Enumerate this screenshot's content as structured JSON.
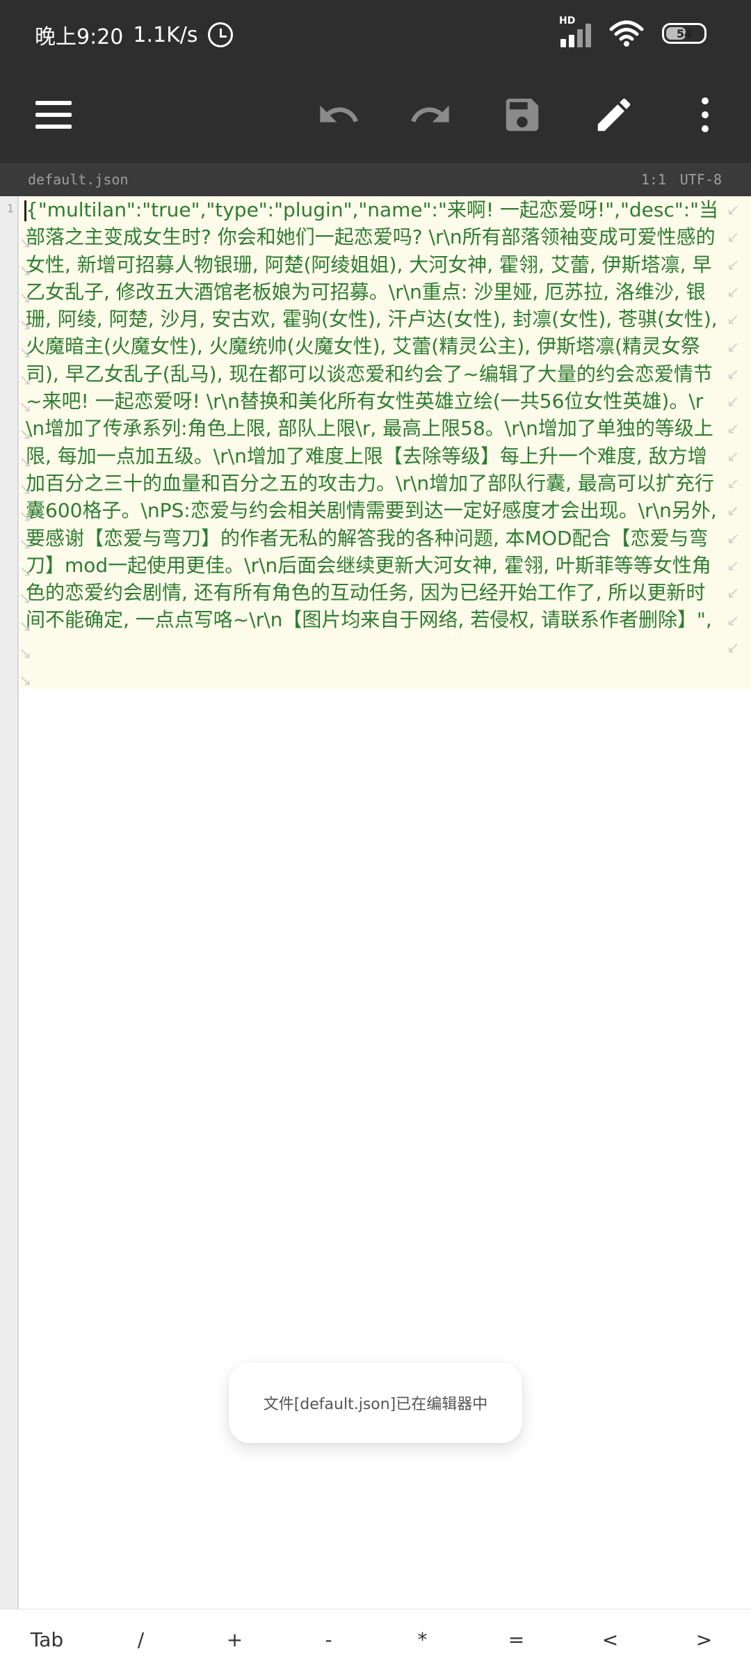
{
  "status_bar": {
    "time": "晚上9:20",
    "net_speed": "1.1K/s",
    "battery_level": "54",
    "signal_label": "HD",
    "icons": [
      "alarm-icon",
      "signal-icon",
      "wifi-icon",
      "battery-icon"
    ]
  },
  "toolbar": {
    "icons": [
      "menu-icon",
      "undo-icon",
      "redo-icon",
      "save-icon",
      "edit-icon",
      "more-vert-icon"
    ]
  },
  "info_bar": {
    "filename": "default.json",
    "cursor_position": "1:1",
    "encoding": "UTF-8"
  },
  "editor": {
    "line_number": "1",
    "content": "{\"multilan\":\"true\",\"type\":\"plugin\",\"name\":\"来啊! 一起恋爱呀!\",\"desc\":\"当部落之主变成女生时? 你会和她们一起恋爱吗? \\r\\n所有部落领袖变成可爱性感的女性, 新增可招募人物银珊, 阿楚(阿绫姐姐), 大河女神, 霍翎, 艾蕾, 伊斯塔凛, 早乙女乱子, 修改五大酒馆老板娘为可招募。\\r\\n重点: 沙里娅, 厄苏拉, 洛维沙, 银珊, 阿绫, 阿楚, 沙月, 安古欢, 霍驹(女性), 汗卢达(女性), 封凛(女性), 苍骐(女性), 火魔暗主(火魔女性), 火魔统帅(火魔女性), 艾蕾(精灵公主), 伊斯塔凛(精灵女祭司), 早乙女乱子(乱马), 现在都可以谈恋爱和约会了~编辑了大量的约会恋爱情节~来吧! 一起恋爱呀! \\r\\n替换和美化所有女性英雄立绘(一共56位女性英雄)。\\r\\n增加了传承系列:角色上限, 部队上限\\r, 最高上限58。\\r\\n增加了单独的等级上限, 每加一点加五级。\\r\\n增加了难度上限【去除等级】每上升一个难度, 敌方增加百分之三十的血量和百分之五的攻击力。\\r\\n增加了部队行囊, 最高可以扩充行囊600格子。\\nPS:恋爱与约会相关剧情需要到达一定好感度才会出现。\\r\\n另外, 要感谢【恋爱与弯刀】的作者无私的解答我的各种问题, 本MOD配合【恋爱与弯刀】mod一起使用更佳。\\r\\n后面会继续更新大河女神, 霍翎, 叶斯菲等等女性角色的恋爱约会剧情, 还有所有角色的互动任务, 因为已经开始工作了, 所以更新时间不能确定, 一点点写咯~\\r\\n【图片均来自于网络, 若侵权, 请联系作者删除】\","
  },
  "toast": {
    "message": "文件[default.json]已在编辑器中"
  },
  "symbol_bar": {
    "keys": [
      "Tab",
      "/",
      "+",
      "-",
      "*",
      "=",
      "<",
      ">"
    ]
  },
  "colors": {
    "toolbar_bg": "#2e2e2e",
    "code_text": "#2e7d32",
    "code_bg": "#fdfbe9",
    "disabled_icon": "#8a8a8a"
  }
}
